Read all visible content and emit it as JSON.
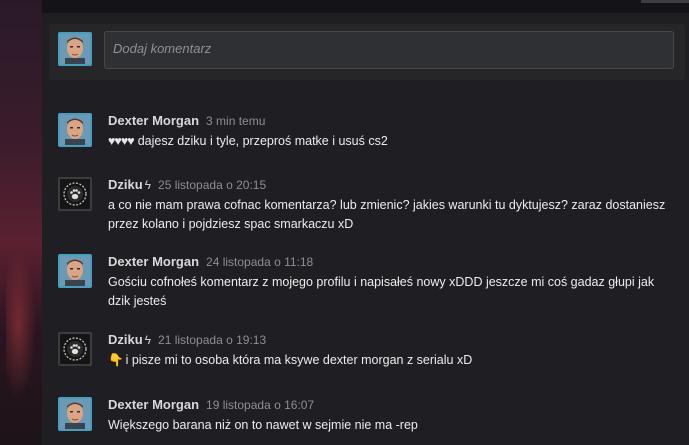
{
  "compose": {
    "placeholder": "Dodaj komentarz"
  },
  "comments": [
    {
      "author": "Dexter Morgan",
      "time": "3 min temu",
      "prefix": "♥♥♥♥",
      "text": "dajesz dziku i tyle, przeproś matke i usuś cs2"
    },
    {
      "author": "Dziku",
      "symbol": "ϟ",
      "time": "25 listopada o 20:15",
      "text": "a co nie mam prawa cofnac komentarza? lub zmienic? jakies warunki tu dyktujesz? zaraz dostaniesz przez kolano i pojdziesz spac smarkaczu xD"
    },
    {
      "author": "Dexter Morgan",
      "time": "24 listopada o 11:18",
      "text": "Gościu cofnołeś komentarz z mojego profilu i napisałeś nowy xDDD jeszcze mi coś gadaz głupi jak dzik jesteś"
    },
    {
      "author": "Dziku",
      "symbol": "ϟ",
      "time": "21 listopada o 19:13",
      "prefix": "👇",
      "text": "i pisze mi to osoba która ma ksywe dexter morgan z serialu xD"
    },
    {
      "author": "Dexter Morgan",
      "time": "19 listopada o 16:07",
      "text": "Większego barana niż on to nawet w sejmie nie ma -rep"
    }
  ]
}
